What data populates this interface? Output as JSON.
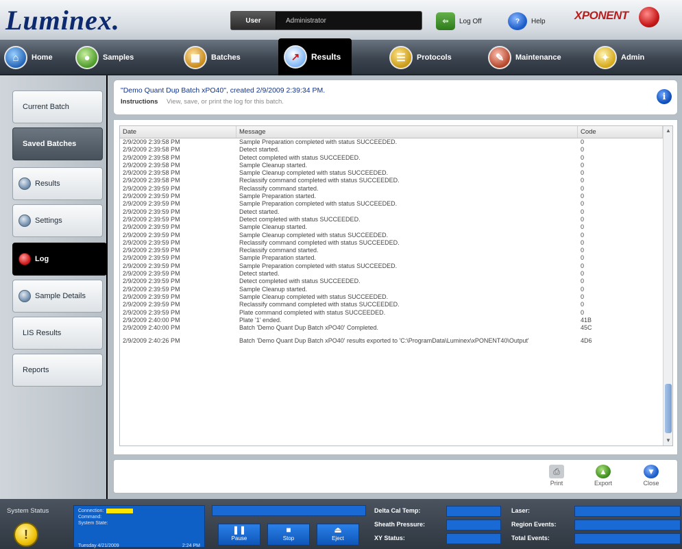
{
  "header": {
    "brand": "Luminex.",
    "user_label": "User",
    "user_value": "Administrator",
    "logoff_label": "Log Off",
    "help_label": "Help",
    "product_logo": "XPONENT"
  },
  "nav": {
    "items": [
      {
        "label": "Home",
        "icon": "home-icon"
      },
      {
        "label": "Samples",
        "icon": "samples-icon"
      },
      {
        "label": "Batches",
        "icon": "batches-icon"
      },
      {
        "label": "Results",
        "icon": "results-icon"
      },
      {
        "label": "Protocols",
        "icon": "protocols-icon"
      },
      {
        "label": "Maintenance",
        "icon": "maintenance-icon"
      },
      {
        "label": "Admin",
        "icon": "admin-icon"
      }
    ],
    "active": "Results"
  },
  "sidebar": {
    "current_batch": "Current Batch",
    "saved_batches": "Saved Batches",
    "results": "Results",
    "settings": "Settings",
    "log": "Log",
    "sample_details": "Sample Details",
    "lis_results": "LIS Results",
    "reports": "Reports"
  },
  "info": {
    "title": "\"Demo Quant Dup Batch xPO40\", created 2/9/2009 2:39:34 PM.",
    "instructions_label": "Instructions",
    "instructions_text": "View, save, or print the log for this batch."
  },
  "log": {
    "columns": [
      "Date",
      "Message",
      "Code"
    ],
    "rows": [
      [
        "2/9/2009 2:39:58 PM",
        "Sample Preparation completed with status SUCCEEDED.",
        "0"
      ],
      [
        "2/9/2009 2:39:58 PM",
        "Detect started.",
        "0"
      ],
      [
        "2/9/2009 2:39:58 PM",
        "Detect completed with status SUCCEEDED.",
        "0"
      ],
      [
        "2/9/2009 2:39:58 PM",
        "Sample Cleanup started.",
        "0"
      ],
      [
        "2/9/2009 2:39:58 PM",
        "Sample Cleanup completed with status SUCCEEDED.",
        "0"
      ],
      [
        "2/9/2009 2:39:58 PM",
        "Reclassify command completed with status SUCCEEDED.",
        "0"
      ],
      [
        "2/9/2009 2:39:59 PM",
        "Reclassify command started.",
        "0"
      ],
      [
        "2/9/2009 2:39:59 PM",
        "Sample Preparation started.",
        "0"
      ],
      [
        "2/9/2009 2:39:59 PM",
        "Sample Preparation completed with status SUCCEEDED.",
        "0"
      ],
      [
        "2/9/2009 2:39:59 PM",
        "Detect started.",
        "0"
      ],
      [
        "2/9/2009 2:39:59 PM",
        "Detect completed with status SUCCEEDED.",
        "0"
      ],
      [
        "2/9/2009 2:39:59 PM",
        "Sample Cleanup started.",
        "0"
      ],
      [
        "2/9/2009 2:39:59 PM",
        "Sample Cleanup completed with status SUCCEEDED.",
        "0"
      ],
      [
        "2/9/2009 2:39:59 PM",
        "Reclassify command completed with status SUCCEEDED.",
        "0"
      ],
      [
        "2/9/2009 2:39:59 PM",
        "Reclassify command started.",
        "0"
      ],
      [
        "2/9/2009 2:39:59 PM",
        "Sample Preparation started.",
        "0"
      ],
      [
        "2/9/2009 2:39:59 PM",
        "Sample Preparation completed with status SUCCEEDED.",
        "0"
      ],
      [
        "2/9/2009 2:39:59 PM",
        "Detect started.",
        "0"
      ],
      [
        "2/9/2009 2:39:59 PM",
        "Detect completed with status SUCCEEDED.",
        "0"
      ],
      [
        "2/9/2009 2:39:59 PM",
        "Sample Cleanup started.",
        "0"
      ],
      [
        "2/9/2009 2:39:59 PM",
        "Sample Cleanup completed with status SUCCEEDED.",
        "0"
      ],
      [
        "2/9/2009 2:39:59 PM",
        "Reclassify command completed with status SUCCEEDED.",
        "0"
      ],
      [
        "2/9/2009 2:39:59 PM",
        "Plate command completed with status SUCCEEDED.",
        "0"
      ],
      [
        "2/9/2009 2:40:00 PM",
        "Plate '1' ended.",
        "41B"
      ],
      [
        "2/9/2009 2:40:00 PM",
        "Batch 'Demo Quant Dup Batch xPO40' Completed.",
        "45C"
      ],
      [
        "2/9/2009 2:40:26 PM",
        "Batch 'Demo Quant Dup Batch xPO40' results exported to 'C:\\ProgramData\\Luminex\\xPONENT40\\Output'",
        "4D6"
      ]
    ]
  },
  "actions": {
    "print": "Print",
    "export": "Export",
    "close": "Close"
  },
  "status": {
    "system_status_label": "System Status",
    "connection_label": "Connection:",
    "command_label": "Command:",
    "system_state_label": "System State:",
    "date_label": "Tuesday 4/21/2009",
    "time_label": "2:24 PM",
    "pause_label": "Pause",
    "stop_label": "Stop",
    "eject_label": "Eject",
    "delta_cal_temp": "Delta Cal Temp:",
    "sheath_pressure": "Sheath Pressure:",
    "xy_status": "XY Status:",
    "laser": "Laser:",
    "region_events": "Region Events:",
    "total_events": "Total Events:"
  },
  "colors": {
    "accent_blue": "#0e5fc6",
    "brand_navy": "#0e2a6e",
    "selected_red": "#d01f1f",
    "warning_yellow": "#f0c20a"
  }
}
